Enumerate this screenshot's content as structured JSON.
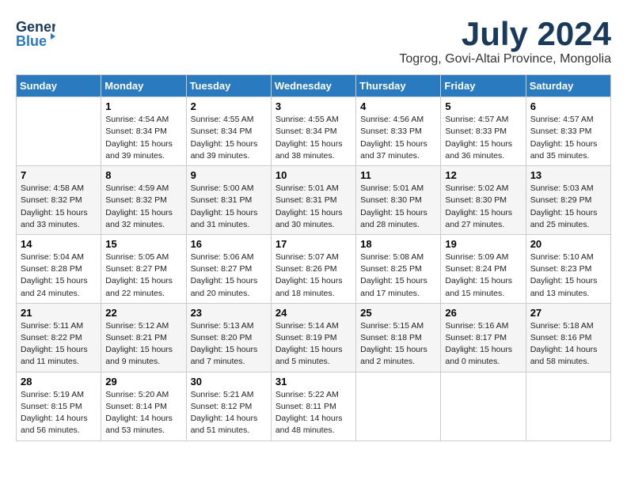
{
  "header": {
    "logo_line1": "General",
    "logo_line2": "Blue",
    "month": "July 2024",
    "location": "Togrog, Govi-Altai Province, Mongolia"
  },
  "weekdays": [
    "Sunday",
    "Monday",
    "Tuesday",
    "Wednesday",
    "Thursday",
    "Friday",
    "Saturday"
  ],
  "weeks": [
    [
      {
        "day": "",
        "info": ""
      },
      {
        "day": "1",
        "info": "Sunrise: 4:54 AM\nSunset: 8:34 PM\nDaylight: 15 hours\nand 39 minutes."
      },
      {
        "day": "2",
        "info": "Sunrise: 4:55 AM\nSunset: 8:34 PM\nDaylight: 15 hours\nand 39 minutes."
      },
      {
        "day": "3",
        "info": "Sunrise: 4:55 AM\nSunset: 8:34 PM\nDaylight: 15 hours\nand 38 minutes."
      },
      {
        "day": "4",
        "info": "Sunrise: 4:56 AM\nSunset: 8:33 PM\nDaylight: 15 hours\nand 37 minutes."
      },
      {
        "day": "5",
        "info": "Sunrise: 4:57 AM\nSunset: 8:33 PM\nDaylight: 15 hours\nand 36 minutes."
      },
      {
        "day": "6",
        "info": "Sunrise: 4:57 AM\nSunset: 8:33 PM\nDaylight: 15 hours\nand 35 minutes."
      }
    ],
    [
      {
        "day": "7",
        "info": "Sunrise: 4:58 AM\nSunset: 8:32 PM\nDaylight: 15 hours\nand 33 minutes."
      },
      {
        "day": "8",
        "info": "Sunrise: 4:59 AM\nSunset: 8:32 PM\nDaylight: 15 hours\nand 32 minutes."
      },
      {
        "day": "9",
        "info": "Sunrise: 5:00 AM\nSunset: 8:31 PM\nDaylight: 15 hours\nand 31 minutes."
      },
      {
        "day": "10",
        "info": "Sunrise: 5:01 AM\nSunset: 8:31 PM\nDaylight: 15 hours\nand 30 minutes."
      },
      {
        "day": "11",
        "info": "Sunrise: 5:01 AM\nSunset: 8:30 PM\nDaylight: 15 hours\nand 28 minutes."
      },
      {
        "day": "12",
        "info": "Sunrise: 5:02 AM\nSunset: 8:30 PM\nDaylight: 15 hours\nand 27 minutes."
      },
      {
        "day": "13",
        "info": "Sunrise: 5:03 AM\nSunset: 8:29 PM\nDaylight: 15 hours\nand 25 minutes."
      }
    ],
    [
      {
        "day": "14",
        "info": "Sunrise: 5:04 AM\nSunset: 8:28 PM\nDaylight: 15 hours\nand 24 minutes."
      },
      {
        "day": "15",
        "info": "Sunrise: 5:05 AM\nSunset: 8:27 PM\nDaylight: 15 hours\nand 22 minutes."
      },
      {
        "day": "16",
        "info": "Sunrise: 5:06 AM\nSunset: 8:27 PM\nDaylight: 15 hours\nand 20 minutes."
      },
      {
        "day": "17",
        "info": "Sunrise: 5:07 AM\nSunset: 8:26 PM\nDaylight: 15 hours\nand 18 minutes."
      },
      {
        "day": "18",
        "info": "Sunrise: 5:08 AM\nSunset: 8:25 PM\nDaylight: 15 hours\nand 17 minutes."
      },
      {
        "day": "19",
        "info": "Sunrise: 5:09 AM\nSunset: 8:24 PM\nDaylight: 15 hours\nand 15 minutes."
      },
      {
        "day": "20",
        "info": "Sunrise: 5:10 AM\nSunset: 8:23 PM\nDaylight: 15 hours\nand 13 minutes."
      }
    ],
    [
      {
        "day": "21",
        "info": "Sunrise: 5:11 AM\nSunset: 8:22 PM\nDaylight: 15 hours\nand 11 minutes."
      },
      {
        "day": "22",
        "info": "Sunrise: 5:12 AM\nSunset: 8:21 PM\nDaylight: 15 hours\nand 9 minutes."
      },
      {
        "day": "23",
        "info": "Sunrise: 5:13 AM\nSunset: 8:20 PM\nDaylight: 15 hours\nand 7 minutes."
      },
      {
        "day": "24",
        "info": "Sunrise: 5:14 AM\nSunset: 8:19 PM\nDaylight: 15 hours\nand 5 minutes."
      },
      {
        "day": "25",
        "info": "Sunrise: 5:15 AM\nSunset: 8:18 PM\nDaylight: 15 hours\nand 2 minutes."
      },
      {
        "day": "26",
        "info": "Sunrise: 5:16 AM\nSunset: 8:17 PM\nDaylight: 15 hours\nand 0 minutes."
      },
      {
        "day": "27",
        "info": "Sunrise: 5:18 AM\nSunset: 8:16 PM\nDaylight: 14 hours\nand 58 minutes."
      }
    ],
    [
      {
        "day": "28",
        "info": "Sunrise: 5:19 AM\nSunset: 8:15 PM\nDaylight: 14 hours\nand 56 minutes."
      },
      {
        "day": "29",
        "info": "Sunrise: 5:20 AM\nSunset: 8:14 PM\nDaylight: 14 hours\nand 53 minutes."
      },
      {
        "day": "30",
        "info": "Sunrise: 5:21 AM\nSunset: 8:12 PM\nDaylight: 14 hours\nand 51 minutes."
      },
      {
        "day": "31",
        "info": "Sunrise: 5:22 AM\nSunset: 8:11 PM\nDaylight: 14 hours\nand 48 minutes."
      },
      {
        "day": "",
        "info": ""
      },
      {
        "day": "",
        "info": ""
      },
      {
        "day": "",
        "info": ""
      }
    ]
  ]
}
